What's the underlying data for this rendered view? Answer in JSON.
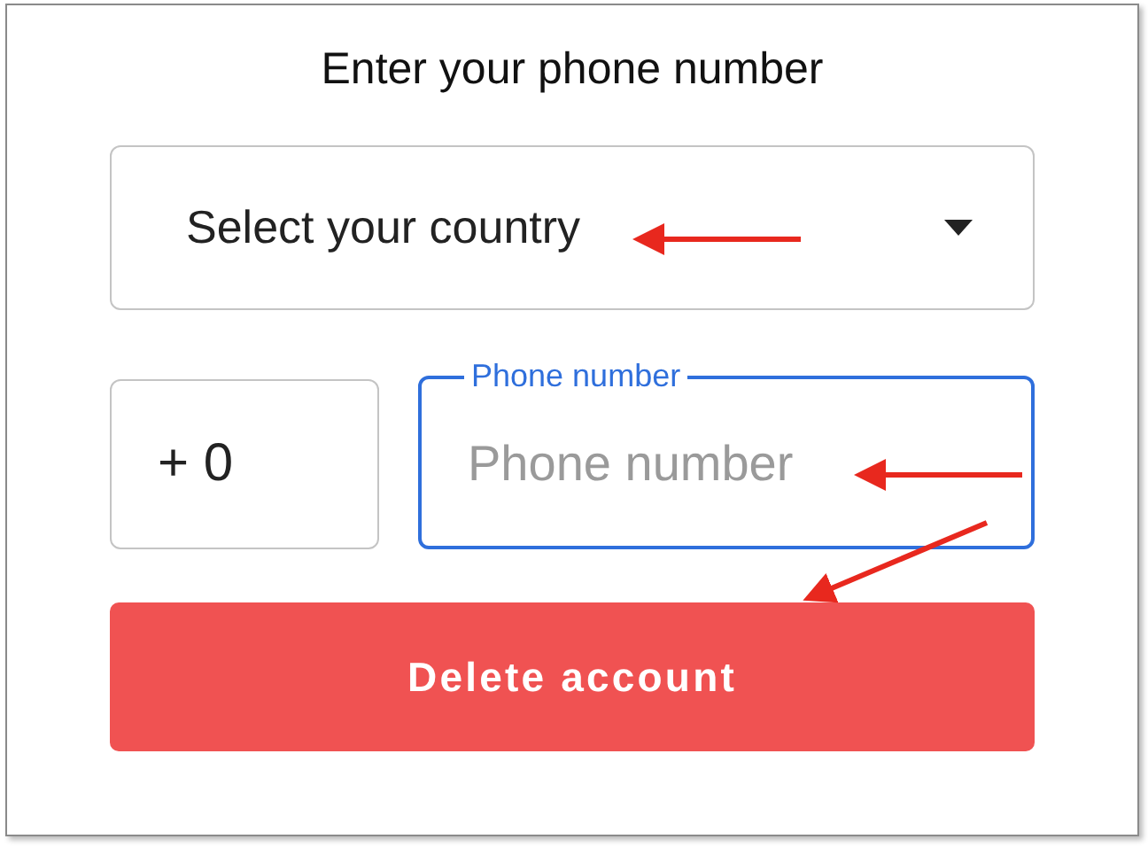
{
  "title": "Enter your phone number",
  "country_select": {
    "value": "Select your country"
  },
  "country_code": {
    "value": "+ 0"
  },
  "phone_field": {
    "label": "Phone number",
    "placeholder": "Phone number",
    "focused": true
  },
  "button": {
    "label": "Delete account"
  }
}
